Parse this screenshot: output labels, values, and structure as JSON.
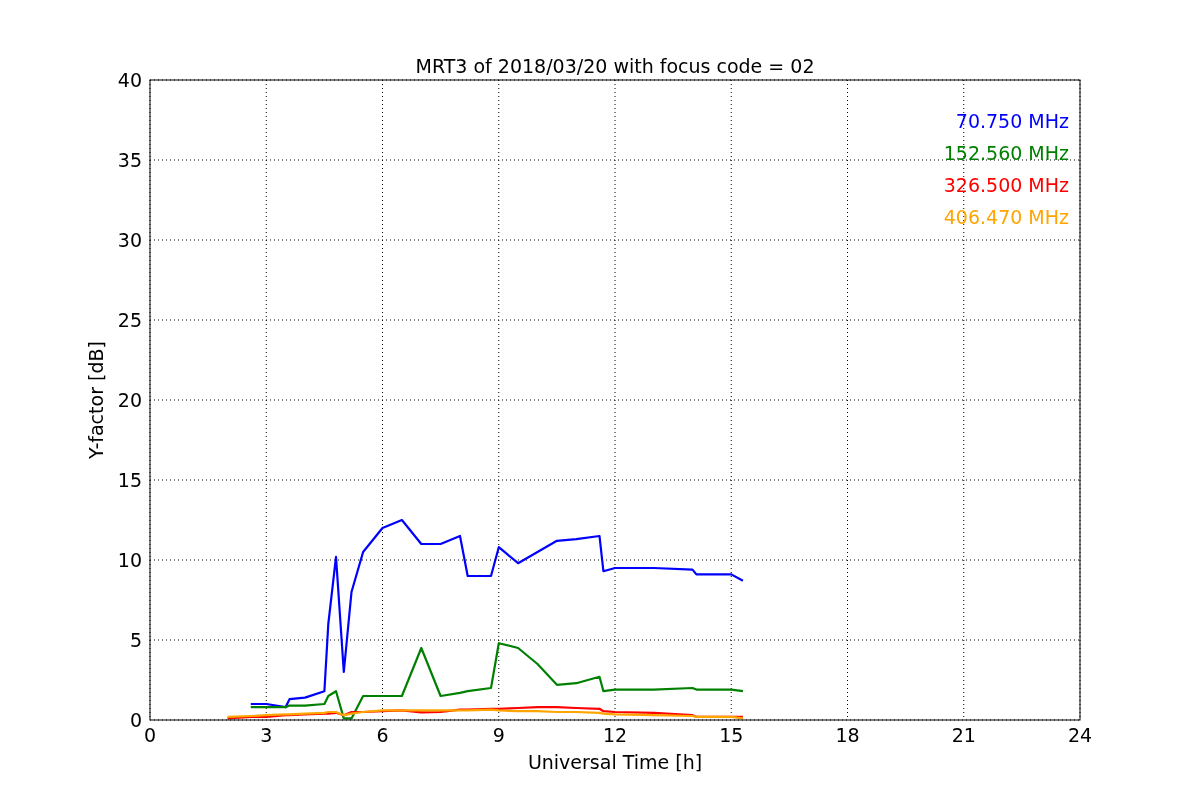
{
  "chart_data": {
    "type": "line",
    "title": "MRT3 of 2018/03/20 with focus code = 02",
    "xlabel": "Universal Time [h]",
    "ylabel": "Y-factor [dB]",
    "x": [
      2.0,
      2.6,
      3.0,
      3.5,
      3.6,
      4.0,
      4.5,
      4.6,
      4.8,
      5.0,
      5.2,
      5.5,
      6.0,
      6.5,
      7.0,
      7.5,
      8.0,
      8.2,
      8.8,
      9.0,
      9.5,
      10.0,
      10.5,
      11.0,
      11.6,
      11.7,
      12.0,
      13.0,
      14.0,
      14.1,
      15.0,
      15.3
    ],
    "series": [
      {
        "name": "70.750 MHz",
        "color": "#0000ff",
        "values": [
          null,
          1.0,
          1.0,
          0.8,
          1.3,
          1.4,
          1.8,
          6.0,
          10.2,
          3.0,
          8.0,
          10.5,
          12.0,
          12.5,
          11.0,
          11.0,
          11.5,
          9.0,
          9.0,
          10.8,
          9.8,
          10.5,
          11.2,
          11.3,
          11.5,
          9.3,
          9.5,
          9.5,
          9.4,
          9.1,
          9.1,
          8.7
        ]
      },
      {
        "name": "152.560 MHz",
        "color": "#008000",
        "values": [
          null,
          0.8,
          0.8,
          0.8,
          0.9,
          0.9,
          1.0,
          1.5,
          1.8,
          0.1,
          0.1,
          1.5,
          1.5,
          1.5,
          4.5,
          1.5,
          1.7,
          1.8,
          2.0,
          4.8,
          4.5,
          3.5,
          2.2,
          2.3,
          2.7,
          1.8,
          1.9,
          1.9,
          2.0,
          1.9,
          1.9,
          1.8
        ]
      },
      {
        "name": "326.500 MHz",
        "color": "#ff0000",
        "values": [
          0.1,
          0.2,
          0.2,
          0.3,
          0.3,
          0.35,
          0.4,
          0.4,
          0.45,
          0.3,
          0.5,
          0.5,
          0.55,
          0.6,
          0.48,
          0.5,
          0.65,
          0.65,
          0.7,
          0.7,
          0.75,
          0.8,
          0.8,
          0.75,
          0.7,
          0.55,
          0.5,
          0.45,
          0.3,
          0.2,
          0.2,
          0.2
        ]
      },
      {
        "name": "406.470 MHz",
        "color": "#ffa500",
        "values": [
          0.2,
          0.25,
          0.3,
          0.35,
          0.35,
          0.4,
          0.45,
          0.5,
          0.5,
          0.3,
          0.4,
          0.5,
          0.6,
          0.6,
          0.6,
          0.6,
          0.6,
          0.6,
          0.65,
          0.6,
          0.55,
          0.55,
          0.5,
          0.5,
          0.45,
          0.4,
          0.35,
          0.3,
          0.25,
          0.2,
          0.2,
          0.1
        ]
      }
    ],
    "xlim": [
      0,
      24
    ],
    "ylim": [
      0,
      40
    ],
    "grid": true,
    "xticks": [
      0,
      3,
      6,
      9,
      12,
      15,
      18,
      21,
      24
    ],
    "yticks": [
      0,
      5,
      10,
      15,
      20,
      25,
      30,
      35,
      40
    ]
  }
}
